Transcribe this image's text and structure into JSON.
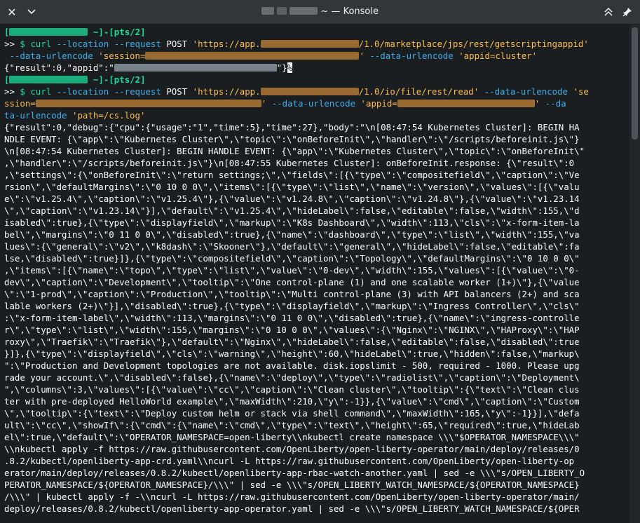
{
  "window": {
    "title": "~ — Konsole",
    "title_host_redacted": "user@host",
    "close_glyph": "✕",
    "menu_glyph": "⌄",
    "keep_above_glyph": "⌃",
    "pin_glyph": "📌"
  },
  "colors": {
    "prompt": "#1cdc9a",
    "option": "#3daee9",
    "string": "#fdbc4b",
    "text": "#fcfcfc",
    "background": "#1b1e20"
  },
  "terminal": {
    "prompt_tty": "pts/2",
    "cmd1": {
      "curl": "curl",
      "location": "--location",
      "request": "--request",
      "method": "POST",
      "url_prefix": "'https://app.",
      "url_suffix": "/1.0/marketplace/jps/rest/getscriptingappid'",
      "urlencode": "--data-urlencode",
      "session_prefix": "'session=",
      "session_suffix": "'",
      "appid": "'appid=cluster'",
      "result": "{\"result\":0,\"appid\":\"",
      "result_end": "\"}"
    },
    "cmd2": {
      "url_suffix": "/1.0/io/file/rest/read'",
      "se": "'se",
      "ssion_prefix": "ssion=",
      "appid_prefix": "'appid=",
      "path": "'path=/cs.log'",
      "da": "--da",
      "ta_urlencode": "ta-urlencode"
    },
    "output_lines": [
      "{\"result\":0,\"debug\":{\"cpu\":{\"usage\":\"1\",\"time\":5},\"time\":27},\"body\":\"\\n[08:47:54 Kubernetes Cluster]: BEGIN HA",
      "NDLE EVENT: {\\\"app\\\":\\\"Kubernetes Cluster\\\",\\\"topic\\\":\\\"onBeforeInit\\\",\\\"handler\\\":\\\"/scripts/beforeinit.js\\\"}",
      "\\n[08:47:54 Kubernetes Cluster]: BEGIN HANDLE EVENT: {\\\"app\\\":\\\"Kubernetes Cluster\\\",\\\"topic\\\":\\\"onBeforeInit\\\"",
      ",\\\"handler\\\":\\\"/scripts/beforeinit.js\\\"}\\n[08:47:55 Kubernetes Cluster]: onBeforeInit.response: {\\\"result\\\":0",
      ",\\\"settings\\\":{\\\"onBeforeInit\\\":\\\"return settings;\\\",\\\"fields\\\":[{\\\"type\\\":\\\"compositefield\\\",\\\"caption\\\":\\\"Ve",
      "rsion\\\",\\\"defaultMargins\\\":\\\"0 10 0 0\\\",\\\"items\\\":[{\\\"type\\\":\\\"list\\\",\\\"name\\\":\\\"version\\\",\\\"values\\\":[{\\\"valu",
      "e\\\":\\\"v1.25.4\\\",\\\"caption\\\":\\\"v1.25.4\\\"},{\\\"value\\\":\\\"v1.24.8\\\",\\\"caption\\\":\\\"v1.24.8\\\"},{\\\"value\\\":\\\"v1.23.14",
      "\\\",\\\"caption\\\":\\\"v1.23.14\\\"}],\\\"default\\\":\\\"v1.25.4\\\",\\\"hideLabel\\\":false,\\\"editable\\\":false,\\\"width\\\":155,\\\"d",
      "isabled\\\":true},{\\\"type\\\":\\\"displayfield\\\",\\\"markup\\\":\\\"K8s Dashboard\\\",\\\"width\\\":113,\\\"cls\\\":\\\"x-form-item-la",
      "bel\\\",\\\"margins\\\":\\\"0 11 0 0\\\",\\\"disabled\\\":true},{\\\"name\\\":\\\"dashboard\\\",\\\"type\\\":\\\"list\\\",\\\"width\\\":155,\\\"va",
      "lues\\\":{\\\"general\\\":\\\"v2\\\",\\\"k8dash\\\":\\\"Skooner\\\"},\\\"default\\\":\\\"general\\\",\\\"hideLabel\\\":false,\\\"editable\\\":fa",
      "lse,\\\"disabled\\\":true}]},{\\\"type\\\":\\\"compositefield\\\",\\\"caption\\\":\\\"Topology\\\",\\\"defaultMargins\\\":\\\"0 10 0 0\\\"",
      ",\\\"items\\\":[{\\\"name\\\":\\\"topo\\\",\\\"type\\\":\\\"list\\\",\\\"value\\\":\\\"0-dev\\\",\\\"width\\\":155,\\\"values\\\":[{\\\"value\\\":\\\"0-",
      "dev\\\",\\\"caption\\\":\\\"Development\\\",\\\"tooltip\\\":\\\"One control-plane (1) and one scalable worker (1+)\\\"},{\\\"value",
      "\\\":\\\"1-prod\\\",\\\"caption\\\":\\\"Production\\\",\\\"tooltip\\\":\\\"Multi control-plane (3) with API balancers (2+) and sca",
      "lable workers (2+)\\\"}],\\\"disabled\\\":true},{\\\"type\\\":\\\"displayfield\\\",\\\"markup\\\":\\\"Ingress Controller\\\",\\\"cls\\\"",
      ":\\\"x-form-item-label\\\",\\\"width\\\":113,\\\"margins\\\":\\\"0 11 0 0\\\",\\\"disabled\\\":true},{\\\"name\\\":\\\"ingress-controlle",
      "r\\\",\\\"type\\\":\\\"list\\\",\\\"width\\\":155,\\\"margins\\\":\\\"0 10 0 0\\\",\\\"values\\\":{\\\"Nginx\\\":\\\"NGINX\\\",\\\"HAProxy\\\":\\\"HAP",
      "roxy\\\",\\\"Traefik\\\":\\\"Traefik\\\"},\\\"default\\\":\\\"Nginx\\\",\\\"hideLabel\\\":false,\\\"editable\\\":false,\\\"disabled\\\":true",
      "}]},{\\\"type\\\":\\\"displayfield\\\",\\\"cls\\\":\\\"warning\\\",\\\"height\\\":60,\\\"hideLabel\\\":true,\\\"hidden\\\":false,\\\"markup\\",
      "\":\\\"Production and Development topologies are not available. disk.iopslimit - 500, required - 1000. Please upg",
      "rade your account.\\\",\\\"disabled\\\":false},{\\\"name\\\":\\\"deploy\\\",\\\"type\\\":\\\"radiolist\\\",\\\"caption\\\":\\\"Deployment\\",
      "\",\\\"columns\\\":3,\\\"values\\\":[{\\\"value\\\":\\\"cc\\\",\\\"caption\\\":\\\"Clean cluster\\\",\\\"tooltip\\\":{\\\"text\\\":\\\"Clean clus",
      "ter with pre-deployed HelloWorld example\\\",\\\"maxWidth\\\":210,\\\"y\\\":-1}},{\\\"value\\\":\\\"cmd\\\",\\\"caption\\\":\\\"Custom",
      "\\\",\\\"tooltip\\\":{\\\"text\\\":\\\"Deploy custom helm or stack via shell command\\\",\\\"maxWidth\\\":165,\\\"y\\\":-1}}],\\\"defa",
      "ult\\\":\\\"cc\\\",\\\"showIf\\\":{\\\"cmd\\\":{\\\"name\\\":\\\"cmd\\\",\\\"type\\\":\\\"text\\\",\\\"height\\\":65,\\\"required\\\":true,\\\"hideLab",
      "el\\\":true,\\\"default\\\":\\\"OPERATOR_NAMESPACE=open-liberty\\\\nkubectl create namespace \\\\\\\"$OPERATOR_NAMESPACE\\\\\\\"",
      "\\\\nkubectl apply -f https://raw.githubusercontent.com/OpenLiberty/open-liberty-operator/main/deploy/releases/0",
      ".8.2/kubectl/openliberty-app-crd.yaml\\\\ncurl -L https://raw.githubusercontent.com/OpenLiberty/open-liberty-op",
      "erator/main/deploy/releases/0.8.2/kubectl/openliberty-app-rbac-watch-another.yaml | sed -e \\\\\\\"s/OPEN_LIBERTY_O",
      "PERATOR_NAMESPACE/${OPERATOR_NAMESPACE}/\\\\\\\" | sed -e \\\\\\\"s/OPEN_LIBERTY_WATCH_NAMESPACE/${OPERATOR_NAMESPACE}",
      "/\\\\\\\" | kubectl apply -f -\\\\ncurl -L https://raw.githubusercontent.com/OpenLiberty/open-liberty-operator/main/",
      "deploy/releases/0.8.2/kubectl/openliberty-app-operator.yaml | sed -e \\\\\\\"s/OPEN_LIBERTY_WATCH_NAMESPACE/${OPER"
    ]
  }
}
